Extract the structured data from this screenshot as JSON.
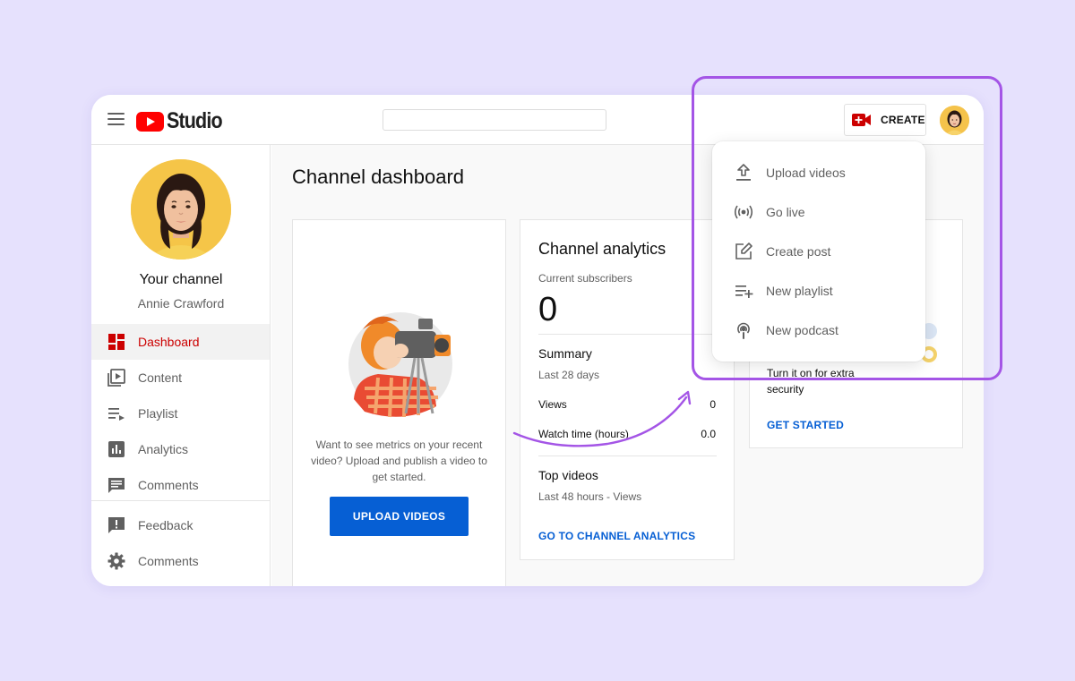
{
  "brand": {
    "logo_text": "Studio",
    "logo_red": "#ff0000",
    "accent_blue": "#065fd4",
    "active_red": "#cc0000",
    "highlight_purple": "#a455e6"
  },
  "header": {
    "search_placeholder": "",
    "create_label": "CREATE"
  },
  "channel": {
    "title": "Your channel",
    "name": "Annie Crawford"
  },
  "sidebar": {
    "items": [
      {
        "label": "Dashboard",
        "icon": "dashboard-icon",
        "active": true
      },
      {
        "label": "Content",
        "icon": "content-icon"
      },
      {
        "label": "Playlist",
        "icon": "playlist-icon"
      },
      {
        "label": "Analytics",
        "icon": "analytics-icon"
      },
      {
        "label": "Comments",
        "icon": "comments-icon"
      }
    ],
    "bottom_items": [
      {
        "label": "Feedback",
        "icon": "feedback-icon"
      },
      {
        "label": "Comments",
        "icon": "settings-gear-icon"
      }
    ]
  },
  "main": {
    "page_title": "Channel dashboard",
    "upload_card": {
      "text": "Want to see metrics on your recent video? Upload and publish a video to get started.",
      "button": "UPLOAD VIDEOS"
    },
    "analytics_card": {
      "title": "Channel analytics",
      "subscribers_label": "Current subscribers",
      "subscribers_value": "0",
      "summary_title": "Summary",
      "summary_period": "Last 28 days",
      "rows": [
        {
          "label": "Views",
          "value": "0"
        },
        {
          "label": "Watch time (hours)",
          "value": "0.0"
        }
      ],
      "top_videos_title": "Top videos",
      "top_videos_period": "Last 48 hours - Views",
      "link": "GO TO CHANNEL ANALYTICS"
    },
    "security_card": {
      "text": "Turn it on for extra security",
      "link": "GET STARTED"
    }
  },
  "create_menu": {
    "items": [
      {
        "label": "Upload videos",
        "icon": "upload-icon"
      },
      {
        "label": "Go live",
        "icon": "live-broadcast-icon"
      },
      {
        "label": "Create post",
        "icon": "edit-post-icon"
      },
      {
        "label": "New playlist",
        "icon": "playlist-add-icon"
      },
      {
        "label": "New podcast",
        "icon": "podcast-icon"
      }
    ]
  }
}
